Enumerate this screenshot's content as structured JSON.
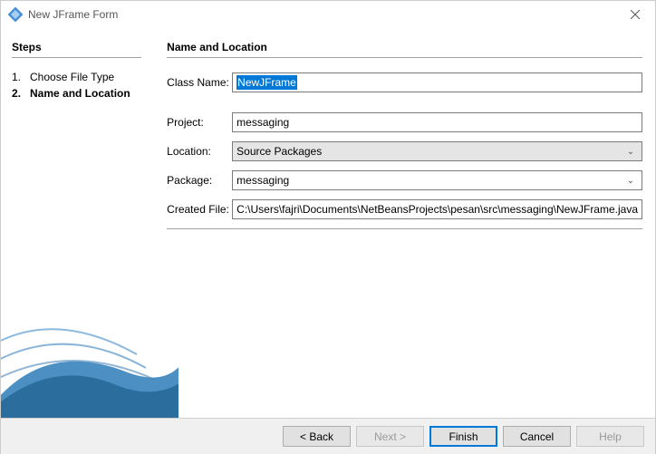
{
  "window": {
    "title": "New JFrame Form"
  },
  "left": {
    "heading": "Steps",
    "steps": [
      {
        "num": "1.",
        "label": "Choose File Type",
        "current": false
      },
      {
        "num": "2.",
        "label": "Name and Location",
        "current": true
      }
    ]
  },
  "right": {
    "heading": "Name and Location",
    "fields": {
      "className": {
        "label": "Class Name:",
        "value": "NewJFrame"
      },
      "project": {
        "label": "Project:",
        "value": "messaging"
      },
      "location": {
        "label": "Location:",
        "value": "Source Packages"
      },
      "package": {
        "label": "Package:",
        "value": "messaging"
      },
      "createdFile": {
        "label": "Created File:",
        "value": "C:\\Users\\fajri\\Documents\\NetBeansProjects\\pesan\\src\\messaging\\NewJFrame.java"
      }
    }
  },
  "buttons": {
    "back": "< Back",
    "next": "Next >",
    "finish": "Finish",
    "cancel": "Cancel",
    "help": "Help"
  }
}
